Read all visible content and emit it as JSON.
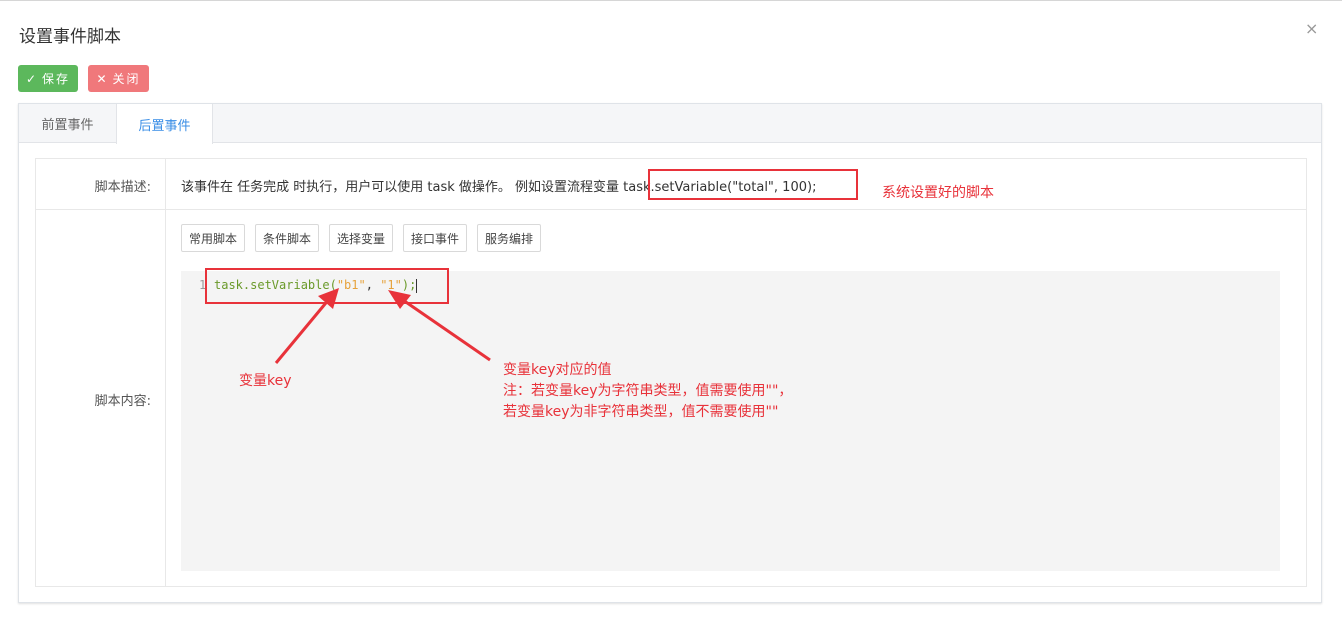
{
  "dialog": {
    "title": "设置事件脚本",
    "close_icon": "×"
  },
  "toolbar": {
    "save_label": "保存",
    "close_label": "关闭"
  },
  "tabs": [
    {
      "label": "前置事件",
      "active": false
    },
    {
      "label": "后置事件",
      "active": true
    }
  ],
  "form": {
    "desc_label": "脚本描述:",
    "desc_text": "该事件在 任务完成 时执行，用户可以使用 task 做操作。 例如设置流程变量 task.setVariable(\"total\", 100);",
    "content_label": "脚本内容:",
    "script_buttons": [
      "常用脚本",
      "条件脚本",
      "选择变量",
      "接口事件",
      "服务编排"
    ]
  },
  "editor": {
    "line_number": "1",
    "code_fn": "task.setVariable(",
    "code_arg1": "\"b1\"",
    "code_sep": ", ",
    "code_arg2": "\"1\"",
    "code_end": ");"
  },
  "annotations": {
    "system_script": "系统设置好的脚本",
    "variable_key": "变量key",
    "value_line1": "变量key对应的值",
    "value_line2": "注：若变量key为字符串类型，值需要使用\"\"，",
    "value_line3": "若变量key为非字符串类型，值不需要使用\"\""
  },
  "colors": {
    "save": "#5cb85c",
    "close": "#f0787b",
    "active_tab": "#3a8ee6",
    "annotation": "#e8323a"
  }
}
